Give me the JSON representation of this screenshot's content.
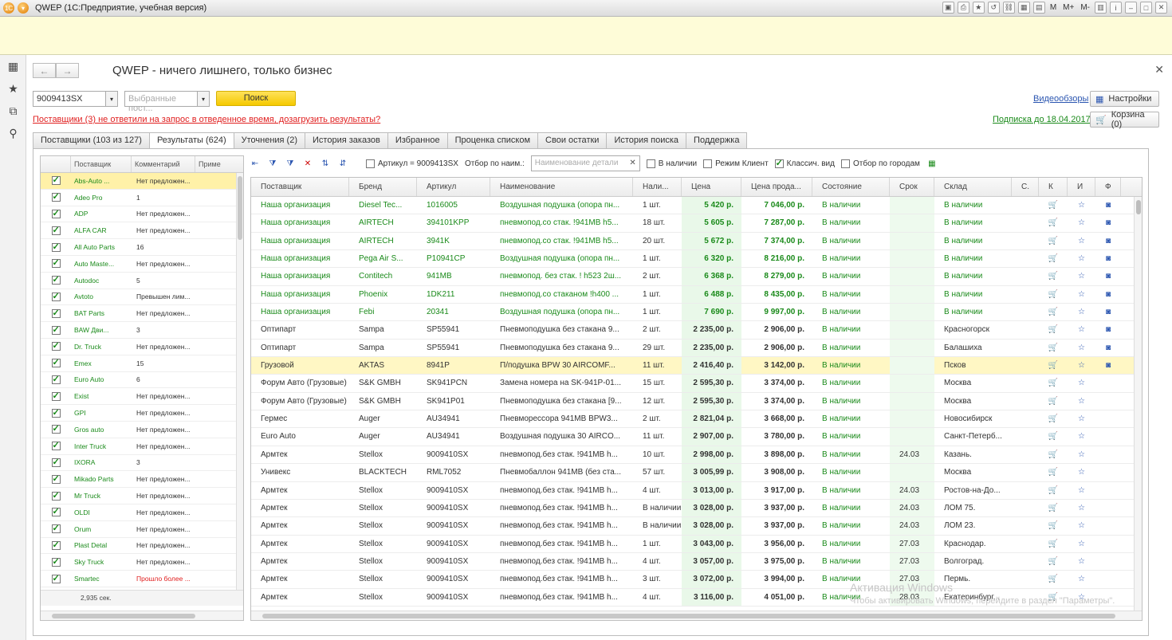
{
  "window": {
    "title": "QWEP  (1С:Предприятие, учебная версия)",
    "right_labels": [
      "M",
      "M+",
      "M-"
    ]
  },
  "app": {
    "title": "QWEP - ничего лишнего, только бизнес"
  },
  "search": {
    "article_value": "9009413SX",
    "suppliers_placeholder": "Выбранные пост...",
    "search_label": "Поиск"
  },
  "warning": "Поставщики (3) не ответили на запрос в отведенное время, дозагрузить результаты?",
  "links": {
    "videos": "Видеообзоры",
    "subscription": "Подписка до 18.04.2017"
  },
  "buttons": {
    "settings": "Настройки",
    "cart": "Корзина (0)"
  },
  "tabs": [
    "Поставщики (103 из 127)",
    "Результаты (624)",
    "Уточнения (2)",
    "История заказов",
    "Избранное",
    "Проценка  списком",
    "Свои остатки",
    "История поиска",
    "Поддержка"
  ],
  "supplier_list": {
    "headers": [
      "Поставщик",
      "Комментарий",
      "Приме"
    ],
    "footer": "2,935 сек.",
    "rows": [
      {
        "name": "Abs-Auto ...",
        "comment": "Нет предложен..."
      },
      {
        "name": "Adeo Pro",
        "comment": "1"
      },
      {
        "name": "ADP",
        "comment": "Нет предложен..."
      },
      {
        "name": "ALFA CAR",
        "comment": "Нет предложен..."
      },
      {
        "name": "All Auto Parts",
        "comment": "16"
      },
      {
        "name": "Auto Maste...",
        "comment": "Нет предложен..."
      },
      {
        "name": "Autodoc",
        "comment": "5"
      },
      {
        "name": "Avtoto",
        "comment": "Превышен лим..."
      },
      {
        "name": "BAT Parts",
        "comment": "Нет предложен..."
      },
      {
        "name": "BAW Дви...",
        "comment": "3"
      },
      {
        "name": "Dr. Truck",
        "comment": "Нет предложен..."
      },
      {
        "name": "Emex",
        "comment": "15"
      },
      {
        "name": "Euro Auto",
        "comment": "6"
      },
      {
        "name": "Exist",
        "comment": "Нет предложен..."
      },
      {
        "name": "GPI",
        "comment": "Нет предложен..."
      },
      {
        "name": "Gros auto",
        "comment": "Нет предложен..."
      },
      {
        "name": "Inter Truck",
        "comment": "Нет предложен..."
      },
      {
        "name": "IXORA",
        "comment": "3"
      },
      {
        "name": "Mikado Parts",
        "comment": "Нет предложен..."
      },
      {
        "name": "Mr Truck",
        "comment": "Нет предложен..."
      },
      {
        "name": "OLDI",
        "comment": "Нет предложен..."
      },
      {
        "name": "Orum",
        "comment": "Нет предложен..."
      },
      {
        "name": "Plast Detal",
        "comment": "Нет предложен..."
      },
      {
        "name": "Sky Truck",
        "comment": "Нет предложен..."
      },
      {
        "name": "Smartec",
        "comment": "Прошло более ..."
      }
    ]
  },
  "filters": {
    "article": "Артикул = 9009413SX",
    "name_label": "Отбор по наим.:",
    "name_placeholder": "Наименование детали",
    "in_stock": "В наличии",
    "client_mode": "Режим Клиент",
    "classic_view": "Классич. вид",
    "city_filter": "Отбор по городам"
  },
  "results": {
    "headers": [
      "Поставщик",
      "Бренд",
      "Артикул",
      "Наименование",
      "Нали...",
      "Цена",
      "Цена прода...",
      "Состояние",
      "Срок",
      "Склад",
      "С.",
      "К",
      "И",
      "Ф"
    ],
    "rows": [
      {
        "supplier": "Наша организация",
        "brand": "Diesel Tec...",
        "article": "1016005",
        "name": "Воздушная подушка (опора пн...",
        "qty": "1 шт.",
        "price": "5 420 р.",
        "sale": "7 046,00 р.",
        "state": "В наличии",
        "term": "",
        "stock": "В наличии",
        "own": true,
        "photo": true
      },
      {
        "supplier": "Наша организация",
        "brand": "AIRTECH",
        "article": "394101KPP",
        "name": "пневмопод.со стак. !941MB h5...",
        "qty": "18 шт.",
        "price": "5 605 р.",
        "sale": "7 287,00 р.",
        "state": "В наличии",
        "term": "",
        "stock": "В наличии",
        "own": true,
        "photo": true
      },
      {
        "supplier": "Наша организация",
        "brand": "AIRTECH",
        "article": "3941K",
        "name": "пневмопод.со стак. !941MB h5...",
        "qty": "20 шт.",
        "price": "5 672 р.",
        "sale": "7 374,00 р.",
        "state": "В наличии",
        "term": "",
        "stock": "В наличии",
        "own": true,
        "photo": true
      },
      {
        "supplier": "Наша организация",
        "brand": "Pega Air S...",
        "article": "P10941CP",
        "name": "Воздушная подушка (опора пн...",
        "qty": "1 шт.",
        "price": "6 320 р.",
        "sale": "8 216,00 р.",
        "state": "В наличии",
        "term": "",
        "stock": "В наличии",
        "own": true,
        "photo": true
      },
      {
        "supplier": "Наша организация",
        "brand": "Contitech",
        "article": "941MB",
        "name": "пневмопод. без стак. ! h523 2ш...",
        "qty": "2 шт.",
        "price": "6 368 р.",
        "sale": "8 279,00 р.",
        "state": "В наличии",
        "term": "",
        "stock": "В наличии",
        "own": true,
        "photo": true
      },
      {
        "supplier": "Наша организация",
        "brand": "Phoenix",
        "article": "1DK211",
        "name": "пневмопод.со стаканом !h400 ...",
        "qty": "1 шт.",
        "price": "6 488 р.",
        "sale": "8 435,00 р.",
        "state": "В наличии",
        "term": "",
        "stock": "В наличии",
        "own": true,
        "photo": true
      },
      {
        "supplier": "Наша организация",
        "brand": "Febi",
        "article": "20341",
        "name": "Воздушная подушка (опора пн...",
        "qty": "1 шт.",
        "price": "7 690 р.",
        "sale": "9 997,00 р.",
        "state": "В наличии",
        "term": "",
        "stock": "В наличии",
        "own": true,
        "photo": true
      },
      {
        "supplier": "Оптипарт",
        "brand": "Sampa",
        "article": "SP55941",
        "name": "Пневмоподушка без стакана 9...",
        "qty": "2 шт.",
        "price": "2 235,00 р.",
        "sale": "2 906,00 р.",
        "state": "В наличии",
        "term": "",
        "stock": "Красногорск",
        "own": false,
        "photo": true
      },
      {
        "supplier": "Оптипарт",
        "brand": "Sampa",
        "article": "SP55941",
        "name": "Пневмоподушка без стакана 9...",
        "qty": "29 шт.",
        "price": "2 235,00 р.",
        "sale": "2 906,00 р.",
        "state": "В наличии",
        "term": "",
        "stock": "Балашиха",
        "own": false,
        "photo": true
      },
      {
        "supplier": "Грузовой",
        "brand": "AKTAS",
        "article": "8941P",
        "name": "П/подушка BPW 30 AIRCOMF...",
        "qty": "11 шт.",
        "price": "2 416,40 р.",
        "sale": "3 142,00 р.",
        "state": "В наличии",
        "term": "",
        "stock": "Псков",
        "own": false,
        "photo": true,
        "selected": true
      },
      {
        "supplier": "Форум Авто (Грузовые)",
        "brand": "S&K GMBH",
        "article": "SK941PCN",
        "name": "Замена номера на SK-941P-01...",
        "qty": "15 шт.",
        "price": "2 595,30 р.",
        "sale": "3 374,00 р.",
        "state": "В наличии",
        "term": "",
        "stock": "Москва",
        "own": false,
        "photo": false
      },
      {
        "supplier": "Форум Авто (Грузовые)",
        "brand": "S&K GMBH",
        "article": "SK941P01",
        "name": "Пневмоподушка без стакана [9...",
        "qty": "12 шт.",
        "price": "2 595,30 р.",
        "sale": "3 374,00 р.",
        "state": "В наличии",
        "term": "",
        "stock": "Москва",
        "own": false,
        "photo": false
      },
      {
        "supplier": "Гермес",
        "brand": "Auger",
        "article": "AU34941",
        "name": "Пневморессора 941MB BPW3...",
        "qty": "2 шт.",
        "price": "2 821,04 р.",
        "sale": "3 668,00 р.",
        "state": "В наличии",
        "term": "",
        "stock": "Новосибирск",
        "own": false,
        "photo": false
      },
      {
        "supplier": "Euro Auto",
        "brand": "Auger",
        "article": "AU34941",
        "name": "Воздушная подушка 30 AIRCO...",
        "qty": "11 шт.",
        "price": "2 907,00 р.",
        "sale": "3 780,00 р.",
        "state": "В наличии",
        "term": "",
        "stock": "Санкт-Петерб...",
        "own": false,
        "photo": false
      },
      {
        "supplier": "Армтек",
        "brand": "Stellox",
        "article": "9009410SX",
        "name": "пневмопод.без стак. !941MB h...",
        "qty": "10 шт.",
        "price": "2 998,00 р.",
        "sale": "3 898,00 р.",
        "state": "В наличии",
        "term": "24.03",
        "stock": "Казань.",
        "own": false,
        "photo": false
      },
      {
        "supplier": "Унивекс",
        "brand": "BLACKTECH",
        "article": "RML7052",
        "name": "Пневмобаллон 941MB (без ста...",
        "qty": "57 шт.",
        "price": "3 005,99 р.",
        "sale": "3 908,00 р.",
        "state": "В наличии",
        "term": "",
        "stock": "Москва",
        "own": false,
        "photo": false
      },
      {
        "supplier": "Армтек",
        "brand": "Stellox",
        "article": "9009410SX",
        "name": "пневмопод.без стак. !941MB h...",
        "qty": "4 шт.",
        "price": "3 013,00 р.",
        "sale": "3 917,00 р.",
        "state": "В наличии",
        "term": "24.03",
        "stock": "Ростов-на-До...",
        "own": false,
        "photo": false
      },
      {
        "supplier": "Армтек",
        "brand": "Stellox",
        "article": "9009410SX",
        "name": "пневмопод.без стак. !941MB h...",
        "qty": "В наличии",
        "price": "3 028,00 р.",
        "sale": "3 937,00 р.",
        "state": "В наличии",
        "term": "24.03",
        "stock": "ЛОМ 75.",
        "own": false,
        "photo": false
      },
      {
        "supplier": "Армтек",
        "brand": "Stellox",
        "article": "9009410SX",
        "name": "пневмопод.без стак. !941MB h...",
        "qty": "В наличии",
        "price": "3 028,00 р.",
        "sale": "3 937,00 р.",
        "state": "В наличии",
        "term": "24.03",
        "stock": "ЛОМ 23.",
        "own": false,
        "photo": false
      },
      {
        "supplier": "Армтек",
        "brand": "Stellox",
        "article": "9009410SX",
        "name": "пневмопод.без стак. !941MB h...",
        "qty": "1 шт.",
        "price": "3 043,00 р.",
        "sale": "3 956,00 р.",
        "state": "В наличии",
        "term": "27.03",
        "stock": "Краснодар.",
        "own": false,
        "photo": false
      },
      {
        "supplier": "Армтек",
        "brand": "Stellox",
        "article": "9009410SX",
        "name": "пневмопод.без стак. !941MB h...",
        "qty": "4 шт.",
        "price": "3 057,00 р.",
        "sale": "3 975,00 р.",
        "state": "В наличии",
        "term": "27.03",
        "stock": "Волгоград.",
        "own": false,
        "photo": false
      },
      {
        "supplier": "Армтек",
        "brand": "Stellox",
        "article": "9009410SX",
        "name": "пневмопод.без стак. !941MB h...",
        "qty": "3 шт.",
        "price": "3 072,00 р.",
        "sale": "3 994,00 р.",
        "state": "В наличии",
        "term": "27.03",
        "stock": "Пермь.",
        "own": false,
        "photo": false
      },
      {
        "supplier": "Армтек",
        "brand": "Stellox",
        "article": "9009410SX",
        "name": "пневмопод.без стак. !941MB h...",
        "qty": "4 шт.",
        "price": "3 116,00 р.",
        "sale": "4 051,00 р.",
        "state": "В наличии",
        "term": "28.03",
        "stock": "Екатеринбург...",
        "own": false,
        "photo": false
      }
    ]
  },
  "watermark": {
    "line1": "Активация Windows",
    "line2": "Чтобы активировать Windows, перейдите в раздел \"Параметры\"."
  }
}
